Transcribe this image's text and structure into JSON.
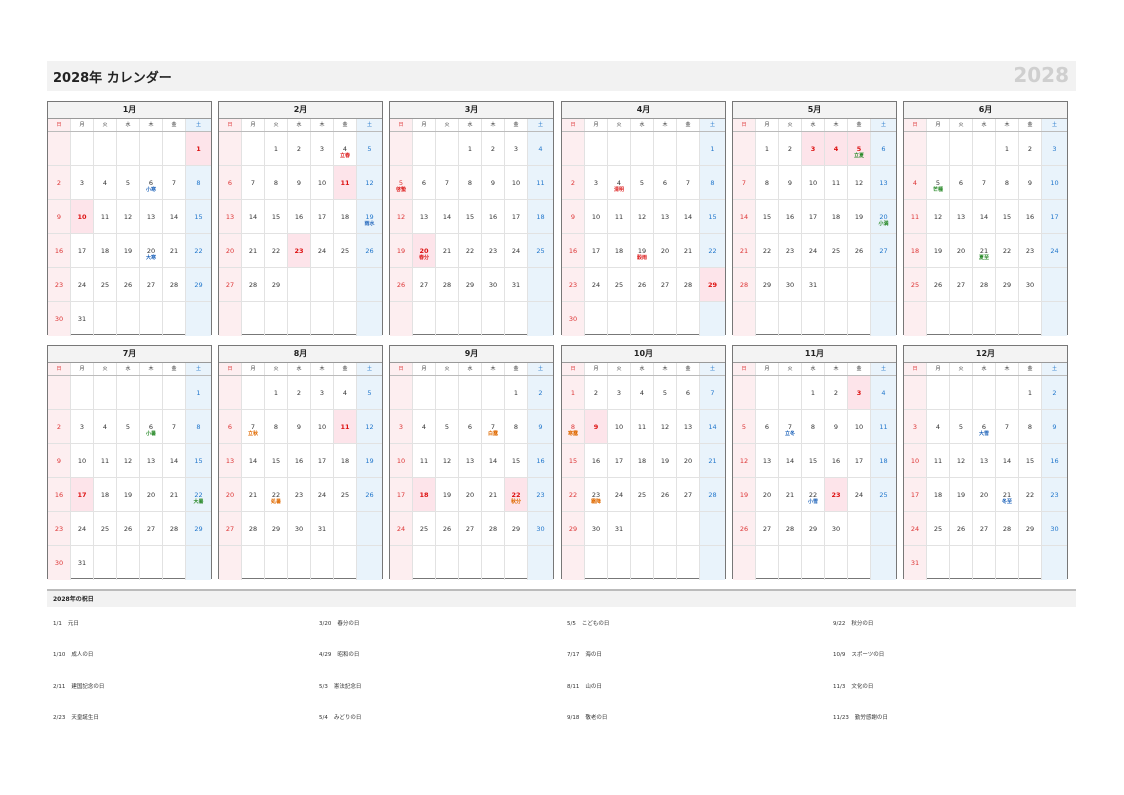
{
  "header": {
    "title": "2028年 カレンダー",
    "year": "2028"
  },
  "weekday_labels": [
    "日",
    "月",
    "火",
    "水",
    "木",
    "金",
    "土"
  ],
  "months": [
    {
      "label": "1月",
      "first_weekday": 6,
      "days": 31,
      "holidays": [
        1,
        10
      ],
      "sekki": [
        {
          "day": 6,
          "label": "小寒",
          "color": "blue"
        },
        {
          "day": 20,
          "label": "大寒",
          "color": "blue"
        }
      ]
    },
    {
      "label": "2月",
      "first_weekday": 2,
      "days": 29,
      "holidays": [
        11,
        23
      ],
      "sekki": [
        {
          "day": 4,
          "label": "立春",
          "color": "red"
        },
        {
          "day": 19,
          "label": "雨水",
          "color": "blue"
        }
      ]
    },
    {
      "label": "3月",
      "first_weekday": 3,
      "days": 31,
      "holidays": [
        20
      ],
      "sekki": [
        {
          "day": 5,
          "label": "啓蟄",
          "color": "red"
        },
        {
          "day": 20,
          "label": "春分",
          "color": "red"
        }
      ]
    },
    {
      "label": "4月",
      "first_weekday": 6,
      "days": 30,
      "holidays": [
        29
      ],
      "sekki": [
        {
          "day": 4,
          "label": "清明",
          "color": "red"
        },
        {
          "day": 19,
          "label": "穀雨",
          "color": "red"
        }
      ]
    },
    {
      "label": "5月",
      "first_weekday": 1,
      "days": 31,
      "holidays": [
        3,
        4,
        5
      ],
      "sekki": [
        {
          "day": 5,
          "label": "立夏",
          "color": "green"
        },
        {
          "day": 20,
          "label": "小満",
          "color": "green"
        }
      ]
    },
    {
      "label": "6月",
      "first_weekday": 4,
      "days": 30,
      "holidays": [],
      "sekki": [
        {
          "day": 5,
          "label": "芒種",
          "color": "green"
        },
        {
          "day": 21,
          "label": "夏至",
          "color": "green"
        }
      ]
    },
    {
      "label": "7月",
      "first_weekday": 6,
      "days": 31,
      "holidays": [
        17
      ],
      "sekki": [
        {
          "day": 6,
          "label": "小暑",
          "color": "green"
        },
        {
          "day": 22,
          "label": "大暑",
          "color": "green"
        }
      ]
    },
    {
      "label": "8月",
      "first_weekday": 2,
      "days": 31,
      "holidays": [
        11
      ],
      "sekki": [
        {
          "day": 7,
          "label": "立秋",
          "color": "orange"
        },
        {
          "day": 22,
          "label": "処暑",
          "color": "orange"
        }
      ]
    },
    {
      "label": "9月",
      "first_weekday": 5,
      "days": 30,
      "holidays": [
        18,
        22
      ],
      "sekki": [
        {
          "day": 7,
          "label": "白露",
          "color": "orange"
        },
        {
          "day": 22,
          "label": "秋分",
          "color": "orange"
        }
      ]
    },
    {
      "label": "10月",
      "first_weekday": 0,
      "days": 31,
      "holidays": [
        9
      ],
      "sekki": [
        {
          "day": 8,
          "label": "寒露",
          "color": "orange"
        },
        {
          "day": 23,
          "label": "霜降",
          "color": "orange"
        }
      ]
    },
    {
      "label": "11月",
      "first_weekday": 3,
      "days": 30,
      "holidays": [
        3,
        23
      ],
      "sekki": [
        {
          "day": 7,
          "label": "立冬",
          "color": "blue"
        },
        {
          "day": 22,
          "label": "小雪",
          "color": "blue"
        }
      ]
    },
    {
      "label": "12月",
      "first_weekday": 5,
      "days": 31,
      "holidays": [],
      "sekki": [
        {
          "day": 6,
          "label": "大雪",
          "color": "blue"
        },
        {
          "day": 21,
          "label": "冬至",
          "color": "blue"
        }
      ]
    }
  ],
  "holidays_section": {
    "title": "2028年の祝日",
    "columns": [
      [
        {
          "date": "1/1",
          "name": "元日"
        },
        {
          "date": "1/10",
          "name": "成人の日"
        },
        {
          "date": "2/11",
          "name": "建国記念の日"
        },
        {
          "date": "2/23",
          "name": "天皇誕生日"
        }
      ],
      [
        {
          "date": "3/20",
          "name": "春分の日"
        },
        {
          "date": "4/29",
          "name": "昭和の日"
        },
        {
          "date": "5/3",
          "name": "憲法記念日"
        },
        {
          "date": "5/4",
          "name": "みどりの日"
        }
      ],
      [
        {
          "date": "5/5",
          "name": "こどもの日"
        },
        {
          "date": "7/17",
          "name": "海の日"
        },
        {
          "date": "8/11",
          "name": "山の日"
        },
        {
          "date": "9/18",
          "name": "敬老の日"
        }
      ],
      [
        {
          "date": "9/22",
          "name": "秋分の日"
        },
        {
          "date": "10/9",
          "name": "スポーツの日"
        },
        {
          "date": "11/3",
          "name": "文化の日"
        },
        {
          "date": "11/23",
          "name": "勤労感謝の日"
        }
      ]
    ]
  }
}
